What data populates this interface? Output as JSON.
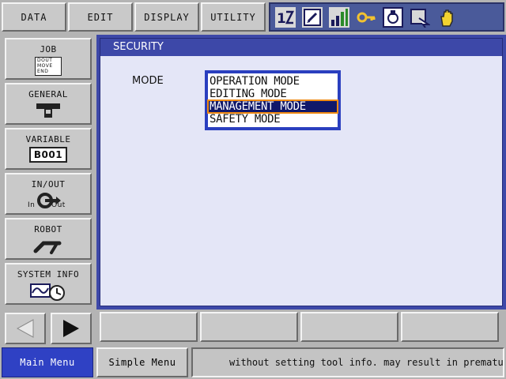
{
  "top_menu": {
    "data": "DATA",
    "edit": "EDIT",
    "display": "DISPLAY",
    "utility": "UTILITY"
  },
  "status_icons": [
    "coordinate-icon",
    "edit-mode-icon",
    "signal-bars-icon",
    "key-icon",
    "tool-icon",
    "teach-icon",
    "hand-icon"
  ],
  "side_menu": {
    "job": {
      "label": "JOB",
      "icon_text": [
        "DOUT",
        "MOVE",
        "END"
      ]
    },
    "general": {
      "label": "GENERAL"
    },
    "variable": {
      "label": "VARIABLE",
      "icon_text": "B001"
    },
    "inout": {
      "label": "IN/OUT",
      "icon_in": "In",
      "icon_out": "Out"
    },
    "robot": {
      "label": "ROBOT"
    },
    "system_info": {
      "label": "SYSTEM INFO"
    }
  },
  "main": {
    "title": "SECURITY",
    "mode_label": "MODE",
    "mode_options": [
      {
        "label": "OPERATION MODE",
        "selected": false
      },
      {
        "label": "EDITING MODE",
        "selected": false
      },
      {
        "label": "MANAGEMENT MODE",
        "selected": true
      },
      {
        "label": "SAFETY MODE",
        "selected": false
      }
    ]
  },
  "status_bar": {
    "main_menu": "Main Menu",
    "simple_menu": "Simple Menu",
    "message": "without setting tool info. may result in prematur"
  },
  "colors": {
    "accent_blue": "#3d48a8",
    "selection_bg": "#10186a",
    "selection_outline": "#f08a12",
    "main_menu_bg": "#2f41c4"
  }
}
